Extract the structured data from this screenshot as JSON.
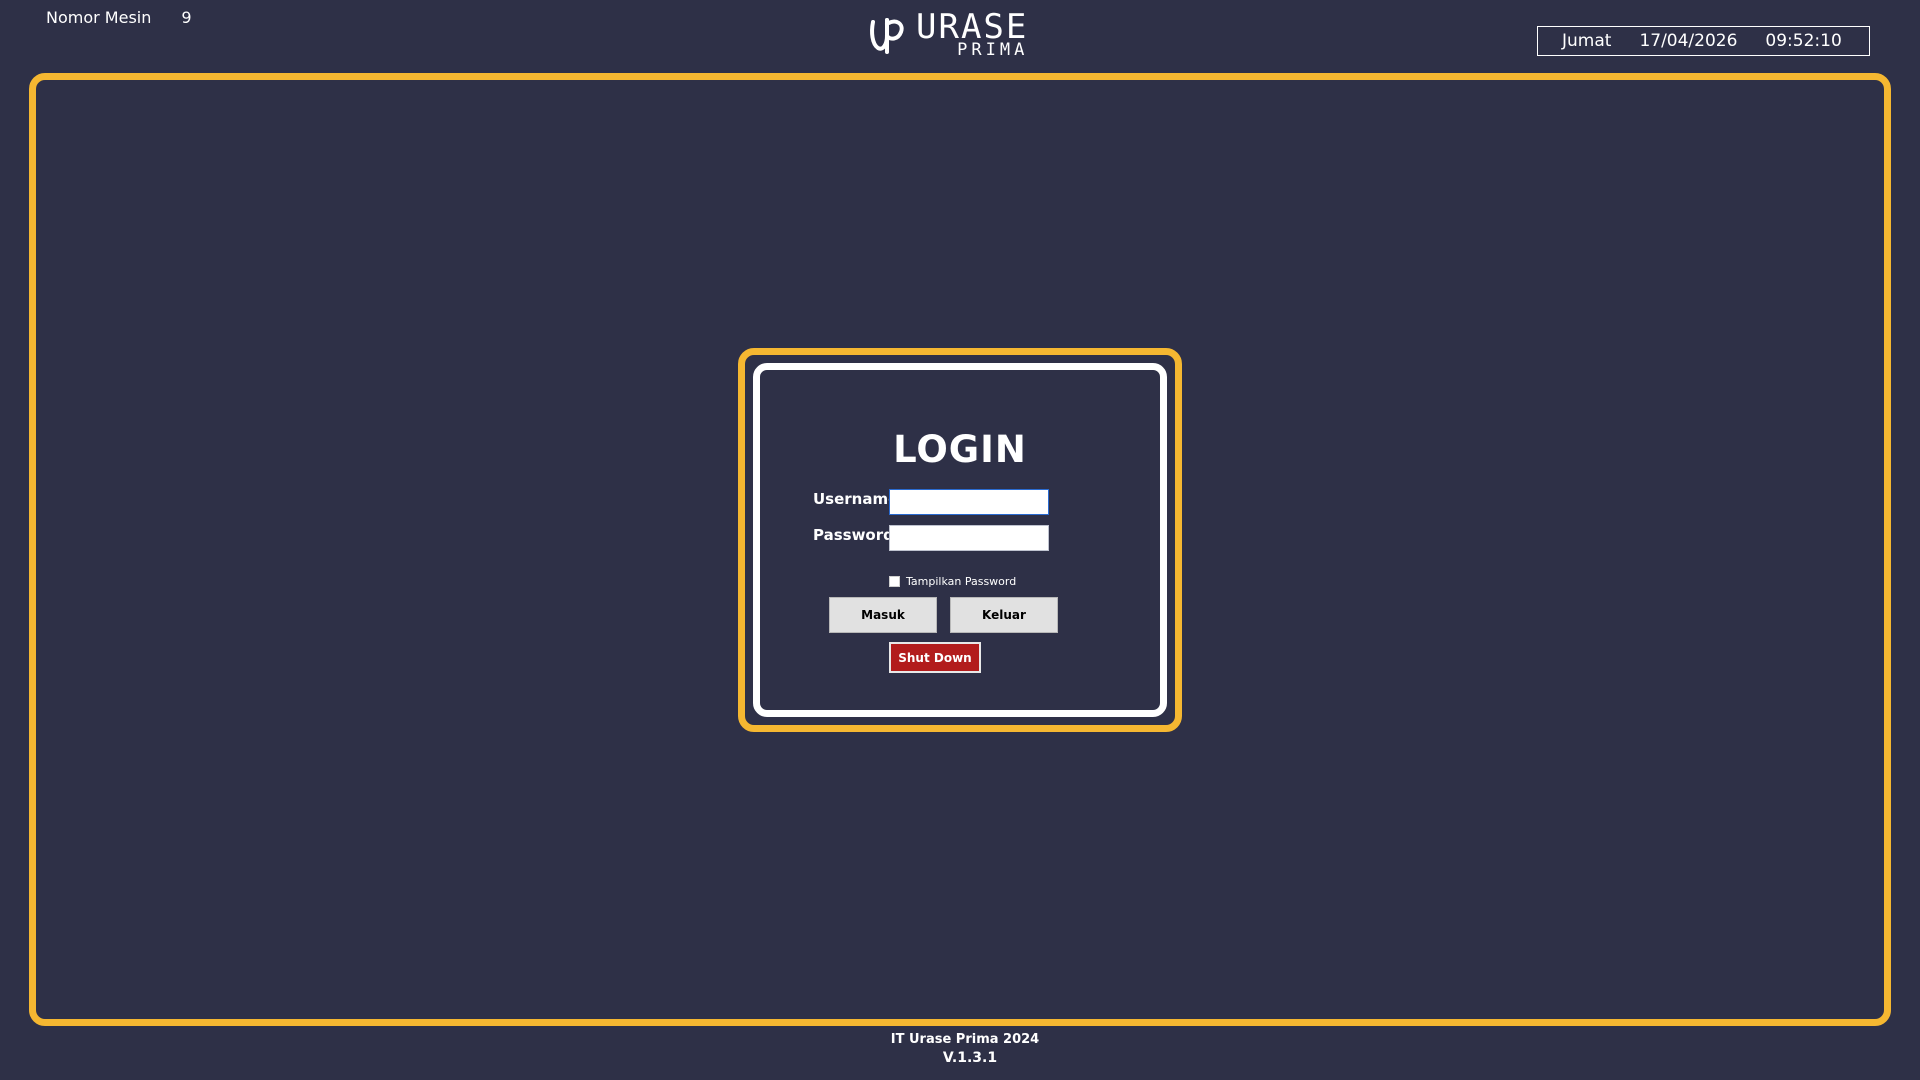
{
  "header": {
    "machine_label": "Nomor Mesin",
    "machine_number": "9",
    "logo_main": "URASE",
    "logo_sub": "PRIMA",
    "day": "Jumat",
    "date": "17/04/2026",
    "time": "09:52:10"
  },
  "login": {
    "title": "LOGIN",
    "username_label": "Username",
    "username_value": "",
    "password_label": "Password",
    "password_value": "",
    "show_password_label": "Tampilkan Password",
    "show_password_checked": false,
    "login_button": "Masuk",
    "exit_button": "Keluar",
    "shutdown_button": "Shut Down"
  },
  "footer": {
    "credit": "IT Urase Prima 2024",
    "version": "V.1.3.1"
  },
  "colors": {
    "background": "#2e3047",
    "accent_yellow": "#f5b731",
    "shutdown_red": "#b21c1c"
  },
  "icons": {
    "logo": "up-monogram-icon"
  }
}
